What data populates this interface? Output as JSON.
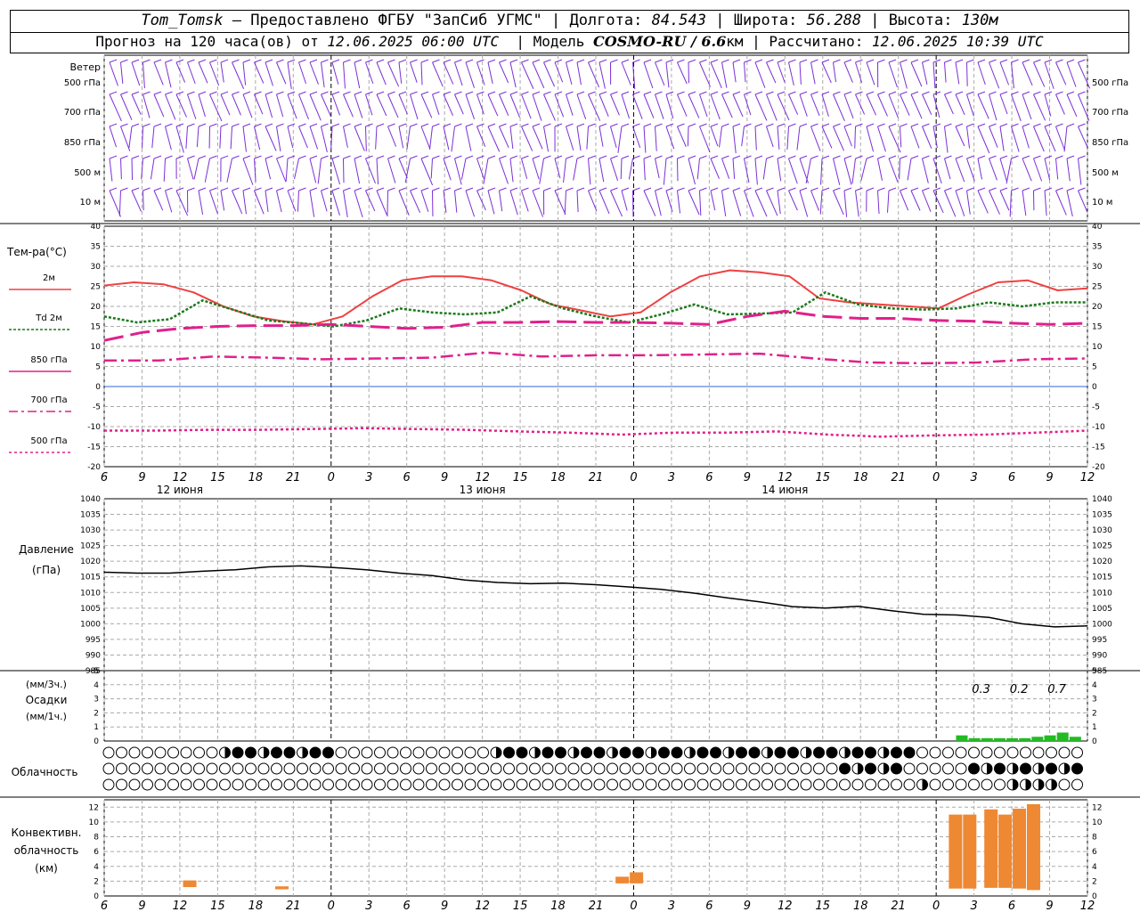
{
  "header": {
    "station": "Tom_Tomsk",
    "provider": "– Предоставлено ФГБУ \"ЗапСиб УГМС\"",
    "lon_label": "Долгота:",
    "lon": "84.543",
    "lat_label": "Широта:",
    "lat": "56.288",
    "alt_label": "Высота:",
    "alt": "130м",
    "fc_label": "Прогноз на 120 часа(ов) от",
    "fc_time": "12.06.2025 06:00 UTC",
    "model_label": "Модель",
    "model": "COSMO-RU / 6.6",
    "model_unit": "км",
    "calc_label": "Рассчитано:",
    "calc_time": "12.06.2025 10:39 UTC"
  },
  "panels": {
    "wind": {
      "title": "Ветер",
      "levels": [
        "500 гПа",
        "700 гПа",
        "850 гПа",
        "500 м",
        "10  м"
      ]
    },
    "temp": {
      "title": "Тем-ра(°С)",
      "legend": [
        {
          "label": "2м",
          "color": "#f04040",
          "dash": ""
        },
        {
          "label": "Td  2м",
          "color": "#1a7a1a",
          "dash": "3,2"
        },
        {
          "label": "850 гПа",
          "color": "#e0208c",
          "dash": ""
        },
        {
          "label": "700 гПа",
          "color": "#e0208c",
          "dash": "10,4,3,4"
        },
        {
          "label": "500 гПа",
          "color": "#e0208c",
          "dash": "3,3"
        }
      ]
    },
    "pressure": {
      "title": "Давление",
      "unit": "(гПа)"
    },
    "precip": {
      "unit3": "(мм/3ч.)",
      "title": "Осадки",
      "unit1": "(мм/1ч.)",
      "totals": [
        "0.3",
        "0.2",
        "0.7"
      ]
    },
    "cloud": {
      "title": "Облачность"
    },
    "conv": {
      "title": [
        "Конвективн.",
        "облачность",
        "(км)"
      ]
    }
  },
  "axis": {
    "hour_labels": [
      "6",
      "9",
      "12",
      "15",
      "18",
      "21",
      "0",
      "3",
      "6",
      "9",
      "12",
      "15",
      "18",
      "21",
      "0",
      "3",
      "6",
      "9",
      "12",
      "15",
      "18",
      "21",
      "0",
      "3",
      "6",
      "9",
      "12"
    ],
    "day_labels": [
      "12 июня",
      "13 июня",
      "14 июня"
    ]
  },
  "chart_data": [
    {
      "type": "line",
      "title": "Тем-ра(°С)",
      "x_hours": [
        0,
        3,
        6,
        9,
        12,
        15,
        18,
        21,
        24,
        27,
        30,
        33,
        36,
        39,
        42,
        45,
        48,
        51,
        54,
        57,
        60,
        63,
        66,
        69,
        72,
        75,
        78
      ],
      "ylim": [
        -20,
        40
      ],
      "series": [
        {
          "name": "2м",
          "values": [
            25.2,
            26,
            25.5,
            23.5,
            20,
            17.5,
            16.3,
            15.5,
            17.5,
            22.5,
            26.5,
            27.5,
            27.5,
            26.5,
            24,
            20.5,
            19,
            17.5,
            18.5,
            23.5,
            27.5,
            29,
            28.5,
            27.5,
            22,
            21,
            20.5,
            20,
            19.5,
            23,
            26,
            26.5,
            24,
            24.5
          ]
        },
        {
          "name": "Td  2м",
          "values": [
            17.5,
            16,
            16.8,
            21.5,
            19,
            16.5,
            15.8,
            15,
            16.5,
            19.5,
            18.5,
            18,
            18.5,
            22.5,
            19.5,
            17.5,
            16,
            18,
            20.5,
            18,
            18.2,
            18.5,
            23.5,
            20.5,
            19.5,
            19.2,
            19.5,
            21,
            20,
            21,
            21
          ]
        },
        {
          "name": "850 гПа",
          "values": [
            11.5,
            13.5,
            14.5,
            15,
            15.2,
            15.2,
            15.5,
            15,
            14.5,
            14.8,
            16,
            16,
            16.2,
            16,
            16,
            15.8,
            15.5,
            17.5,
            18.8,
            17.5,
            17,
            17,
            16.5,
            16.3,
            15.8,
            15.5,
            15.8
          ]
        },
        {
          "name": "700 гПа",
          "values": [
            6.5,
            6.5,
            7.5,
            7.2,
            6.8,
            7,
            7.2,
            8.5,
            7.5,
            7.8,
            7.8,
            8,
            8.2,
            7,
            6,
            5.8,
            6,
            6.8,
            7
          ]
        },
        {
          "name": "500 гПа",
          "values": [
            -11,
            -11,
            -10.8,
            -10.8,
            -10.6,
            -10.4,
            -10.6,
            -10.8,
            -11.2,
            -11.5,
            -12,
            -11.5,
            -11.5,
            -11.2,
            -12,
            -12.5,
            -12.2,
            -12,
            -11.5,
            -11
          ]
        }
      ]
    },
    {
      "type": "line",
      "title": "Давление",
      "ylabel": "(гПа)",
      "ylim": [
        985,
        1040
      ],
      "series": [
        {
          "name": "",
          "values": [
            1016.5,
            1016.2,
            1016.2,
            1016.8,
            1017.3,
            1018.2,
            1018.5,
            1018,
            1017.3,
            1016.2,
            1015.4,
            1014,
            1013.2,
            1012.8,
            1013,
            1012.5,
            1011.8,
            1011,
            1009.8,
            1008.3,
            1007,
            1005.5,
            1005,
            1005.6,
            1004.2,
            1003,
            1002.8,
            1002,
            1000,
            999,
            999.3
          ]
        }
      ]
    },
    {
      "type": "bar",
      "title": "Осадки",
      "ylabel": "(мм/3ч.)",
      "ylim": [
        0,
        5
      ],
      "values": [
        0.3,
        0.2,
        0.7
      ]
    },
    {
      "type": "bar",
      "title": "Конвективн. облачность",
      "ylabel": "(км)",
      "ylim": [
        0,
        13
      ]
    }
  ]
}
